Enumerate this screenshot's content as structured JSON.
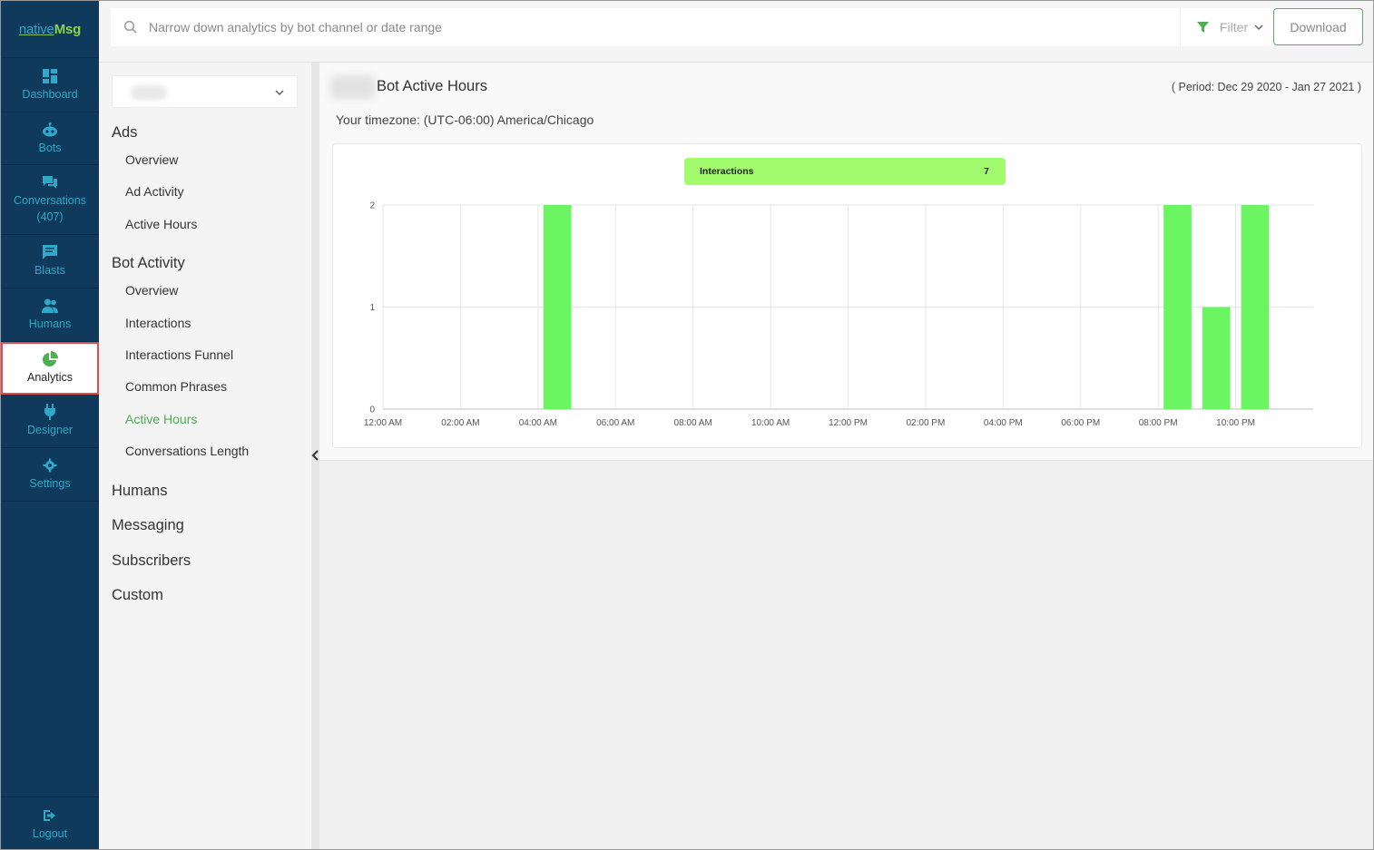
{
  "brand": {
    "logo_part1": "native",
    "logo_part2": "Msg"
  },
  "nav": {
    "items": [
      {
        "label": "Dashboard",
        "icon": "dashboard-icon"
      },
      {
        "label": "Bots",
        "icon": "robot-icon"
      },
      {
        "label": "Conversations",
        "sublabel": "(407)",
        "icon": "chat-icon"
      },
      {
        "label": "Blasts",
        "icon": "message-icon"
      },
      {
        "label": "Humans",
        "icon": "users-icon"
      },
      {
        "label": "Analytics",
        "icon": "pie-chart-icon",
        "active": true
      },
      {
        "label": "Designer",
        "icon": "plug-icon"
      },
      {
        "label": "Settings",
        "icon": "gear-icon"
      }
    ],
    "logout": "Logout"
  },
  "search": {
    "placeholder": "Narrow down analytics by bot channel or date range"
  },
  "filter": {
    "label": "Filter"
  },
  "download": {
    "label": "Download"
  },
  "submenu": {
    "ads": {
      "title": "Ads",
      "items": [
        "Overview",
        "Ad Activity",
        "Active Hours"
      ]
    },
    "bot_activity": {
      "title": "Bot Activity",
      "items": [
        "Overview",
        "Interactions",
        "Interactions Funnel",
        "Common Phrases",
        "Active Hours",
        "Conversations Length"
      ],
      "active": "Active Hours"
    },
    "sections": [
      "Humans",
      "Messaging",
      "Subscribers",
      "Custom"
    ]
  },
  "page": {
    "title": "Bot Active Hours",
    "period": "( Period: Dec 29 2020 - Jan 27 2021 )",
    "timezone": "Your timezone: (UTC-06:00) America/Chicago"
  },
  "colors": {
    "sidebar": "#103a5c",
    "accent": "#4caf50",
    "bar": "#6cf562",
    "legend": "#a2fb6d"
  },
  "chart_data": {
    "type": "bar",
    "categories": [
      "12:00 AM",
      "01:00 AM",
      "02:00 AM",
      "03:00 AM",
      "04:00 AM",
      "05:00 AM",
      "06:00 AM",
      "07:00 AM",
      "08:00 AM",
      "09:00 AM",
      "10:00 AM",
      "11:00 AM",
      "12:00 PM",
      "01:00 PM",
      "02:00 PM",
      "03:00 PM",
      "04:00 PM",
      "05:00 PM",
      "06:00 PM",
      "07:00 PM",
      "08:00 PM",
      "09:00 PM",
      "10:00 PM",
      "11:00 PM"
    ],
    "tick_labels": [
      "12:00 AM",
      "02:00 AM",
      "04:00 AM",
      "06:00 AM",
      "08:00 AM",
      "10:00 AM",
      "12:00 PM",
      "02:00 PM",
      "04:00 PM",
      "06:00 PM",
      "08:00 PM",
      "10:00 PM"
    ],
    "series": [
      {
        "name": "Interactions",
        "total": "7",
        "values": [
          0,
          0,
          0,
          0,
          2,
          0,
          0,
          0,
          0,
          0,
          0,
          0,
          0,
          0,
          0,
          0,
          0,
          0,
          0,
          0,
          2,
          1,
          2,
          0
        ]
      }
    ],
    "yticks": [
      "0",
      "1",
      "2"
    ],
    "ylim": [
      0,
      2
    ],
    "legend_placement": "top-center",
    "grid": true
  }
}
